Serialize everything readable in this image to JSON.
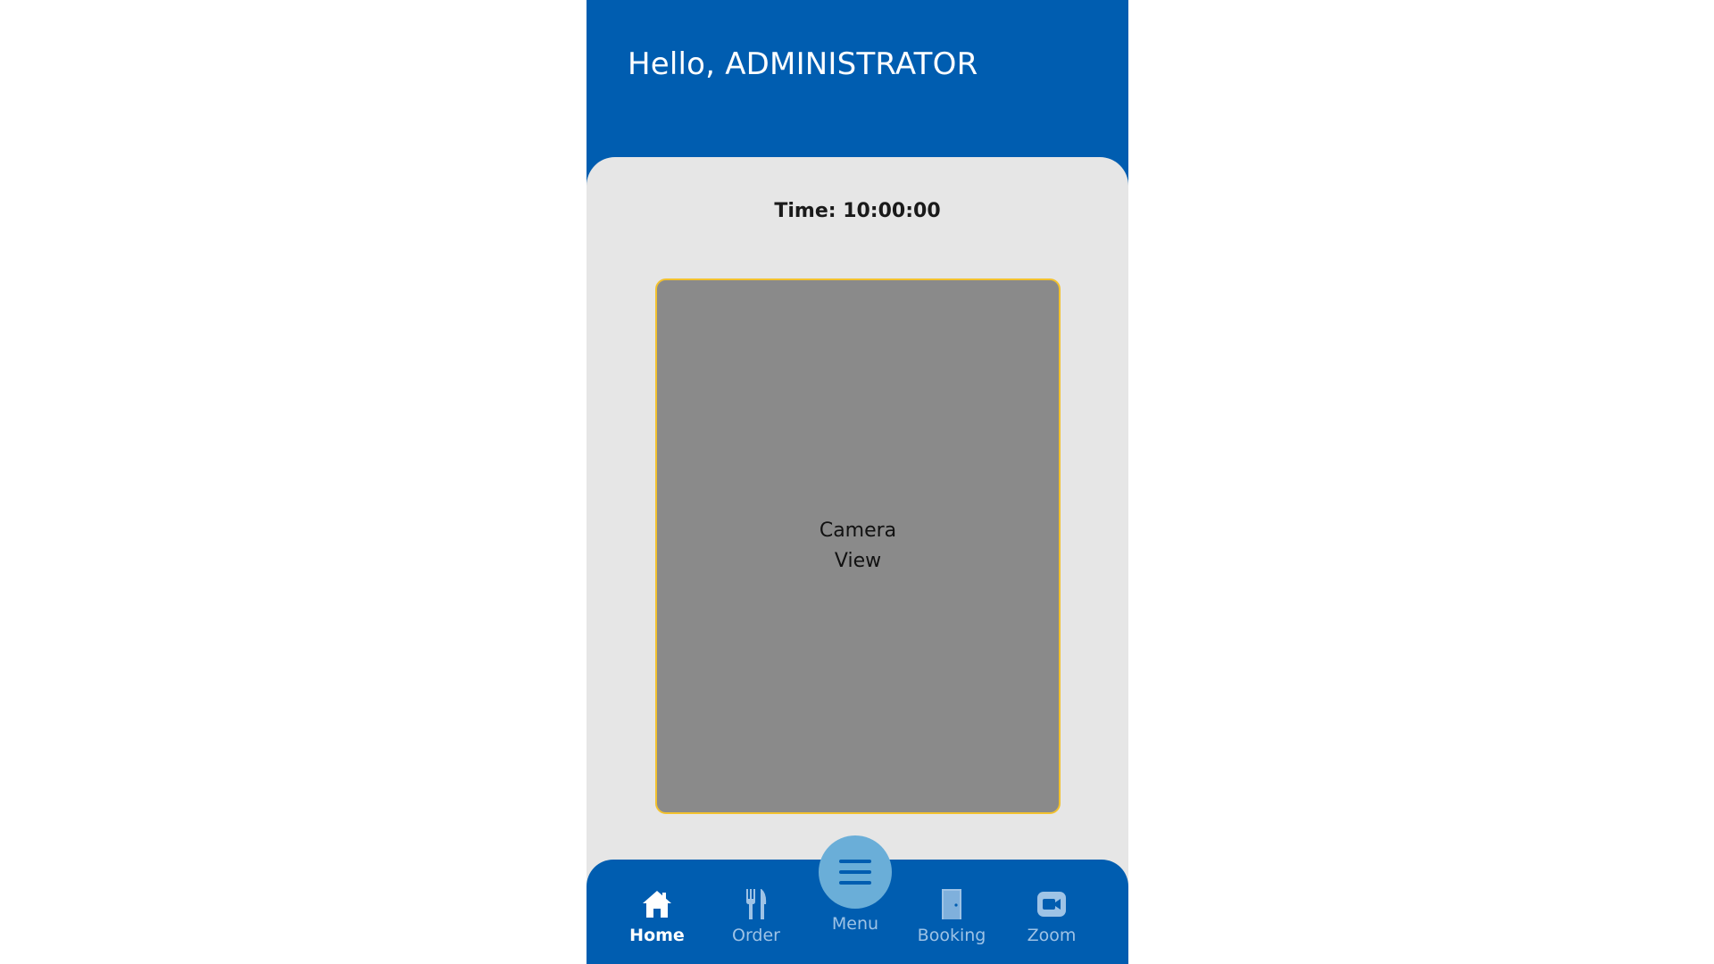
{
  "header": {
    "greeting": "Hello, ADMINISTRATOR"
  },
  "main": {
    "time_text": "Time: 10:00:00",
    "camera": {
      "line1": "Camera",
      "line2": "View"
    }
  },
  "nav": {
    "items": [
      {
        "label": "Home",
        "icon": "home-icon",
        "active": true
      },
      {
        "label": "Order",
        "icon": "fork-knife-icon",
        "active": false
      },
      {
        "label": "Menu",
        "icon": "hamburger-menu-icon",
        "active": false
      },
      {
        "label": "Booking",
        "icon": "door-icon",
        "active": false
      },
      {
        "label": "Zoom",
        "icon": "video-camera-icon",
        "active": false
      }
    ]
  },
  "colors": {
    "primary": "#005db0",
    "background": "#e6e6e6",
    "camera_fill": "#8a8a8a",
    "camera_border": "#f2c12e",
    "fab": "#6aaed8",
    "inactive": "#9ec3e6"
  }
}
